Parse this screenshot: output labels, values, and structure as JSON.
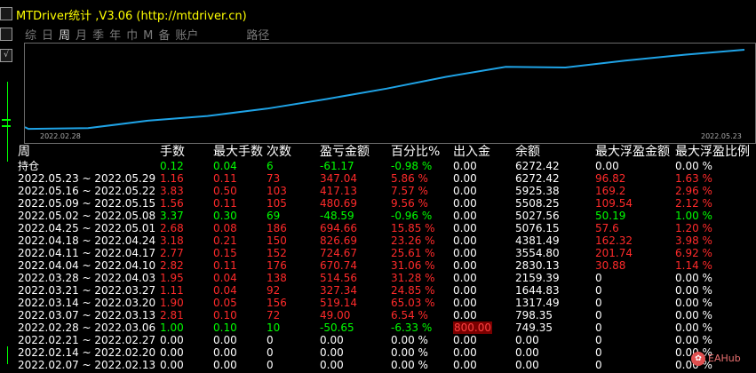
{
  "title": "MTDriver统计 ,V3.06 (http://mtdriver.cn)",
  "tabs": [
    {
      "label": "综"
    },
    {
      "label": "日"
    },
    {
      "label": "周"
    },
    {
      "label": "月"
    },
    {
      "label": "季"
    },
    {
      "label": "年"
    },
    {
      "label": "巾"
    },
    {
      "label": "M"
    },
    {
      "label": "备"
    },
    {
      "label": "账户"
    },
    {
      "label": "路径"
    }
  ],
  "active_tab": "周",
  "chart": {
    "start_date": "2022.02.28",
    "end_date": "2022.05.23",
    "line_color": "#1fa3e6"
  },
  "table": {
    "headers": [
      "周",
      "手数",
      "最大手数",
      "次数",
      "盈亏金额",
      "百分比%",
      "出入金",
      "余额",
      "最大浮盈金额",
      "最大浮盈比例"
    ],
    "rows": [
      {
        "week": "持仓",
        "lots": "0.12",
        "max_lots": "0.04",
        "count": "6",
        "pnl": "-61.17",
        "pct": "-0.98 %",
        "flow": "0.00",
        "balance": "6272.42",
        "max_float": "0.00",
        "max_float_pct": "0.00 %",
        "clr": "g"
      },
      {
        "week": "2022.05.23 ~ 2022.05.29",
        "lots": "1.16",
        "max_lots": "0.11",
        "count": "73",
        "pnl": "347.04",
        "pct": "5.86 %",
        "flow": "0.00",
        "balance": "6272.42",
        "max_float": "96.82",
        "max_float_pct": "1.63 %",
        "clr": "r"
      },
      {
        "week": "2022.05.16 ~ 2022.05.22",
        "lots": "3.83",
        "max_lots": "0.50",
        "count": "103",
        "pnl": "417.13",
        "pct": "7.57 %",
        "flow": "0.00",
        "balance": "5925.38",
        "max_float": "169.2",
        "max_float_pct": "2.96 %",
        "clr": "r"
      },
      {
        "week": "2022.05.09 ~ 2022.05.15",
        "lots": "1.56",
        "max_lots": "0.11",
        "count": "105",
        "pnl": "480.69",
        "pct": "9.56 %",
        "flow": "0.00",
        "balance": "5508.25",
        "max_float": "109.54",
        "max_float_pct": "2.12 %",
        "clr": "r"
      },
      {
        "week": "2022.05.02 ~ 2022.05.08",
        "lots": "3.37",
        "max_lots": "0.30",
        "count": "69",
        "pnl": "-48.59",
        "pct": "-0.96 %",
        "flow": "0.00",
        "balance": "5027.56",
        "max_float": "50.19",
        "max_float_pct": "1.00 %",
        "clr": "g"
      },
      {
        "week": "2022.04.25 ~ 2022.05.01",
        "lots": "2.68",
        "max_lots": "0.08",
        "count": "186",
        "pnl": "694.66",
        "pct": "15.85 %",
        "flow": "0.00",
        "balance": "5076.15",
        "max_float": "57.6",
        "max_float_pct": "1.20 %",
        "clr": "r"
      },
      {
        "week": "2022.04.18 ~ 2022.04.24",
        "lots": "3.18",
        "max_lots": "0.21",
        "count": "150",
        "pnl": "826.69",
        "pct": "23.26 %",
        "flow": "0.00",
        "balance": "4381.49",
        "max_float": "162.32",
        "max_float_pct": "3.98 %",
        "clr": "r"
      },
      {
        "week": "2022.04.11 ~ 2022.04.17",
        "lots": "2.77",
        "max_lots": "0.15",
        "count": "152",
        "pnl": "724.67",
        "pct": "25.61 %",
        "flow": "0.00",
        "balance": "3554.80",
        "max_float": "201.74",
        "max_float_pct": "6.92 %",
        "clr": "r"
      },
      {
        "week": "2022.04.04 ~ 2022.04.10",
        "lots": "2.82",
        "max_lots": "0.11",
        "count": "176",
        "pnl": "670.74",
        "pct": "31.06 %",
        "flow": "0.00",
        "balance": "2830.13",
        "max_float": "30.88",
        "max_float_pct": "1.14 %",
        "clr": "r"
      },
      {
        "week": "2022.03.28 ~ 2022.04.03",
        "lots": "1.95",
        "max_lots": "0.04",
        "count": "138",
        "pnl": "514.56",
        "pct": "31.28 %",
        "flow": "0.00",
        "balance": "2159.39",
        "max_float": "0",
        "max_float_pct": "0.00 %",
        "clr": "r"
      },
      {
        "week": "2022.03.21 ~ 2022.03.27",
        "lots": "1.11",
        "max_lots": "0.04",
        "count": "92",
        "pnl": "327.34",
        "pct": "24.85 %",
        "flow": "0.00",
        "balance": "1644.83",
        "max_float": "0",
        "max_float_pct": "0.00 %",
        "clr": "r"
      },
      {
        "week": "2022.03.14 ~ 2022.03.20",
        "lots": "1.90",
        "max_lots": "0.05",
        "count": "156",
        "pnl": "519.14",
        "pct": "65.03 %",
        "flow": "0.00",
        "balance": "1317.49",
        "max_float": "0",
        "max_float_pct": "0.00 %",
        "clr": "r"
      },
      {
        "week": "2022.03.07 ~ 2022.03.13",
        "lots": "2.81",
        "max_lots": "0.10",
        "count": "72",
        "pnl": "49.00",
        "pct": "6.54 %",
        "flow": "0.00",
        "balance": "798.35",
        "max_float": "0",
        "max_float_pct": "0.00 %",
        "clr": "r"
      },
      {
        "week": "2022.02.28 ~ 2022.03.06",
        "lots": "1.00",
        "max_lots": "0.10",
        "count": "10",
        "pnl": "-50.65",
        "pct": "-6.33 %",
        "flow": "800.00",
        "balance": "749.35",
        "max_float": "0",
        "max_float_pct": "0.00 %",
        "clr": "g",
        "flow_highlight": true
      },
      {
        "week": "2022.02.21 ~ 2022.02.27",
        "lots": "0.00",
        "max_lots": "0.00",
        "count": "0",
        "pnl": "0.00",
        "pct": "0.00 %",
        "flow": "0.00",
        "balance": "0.00",
        "max_float": "0",
        "max_float_pct": "0.00 %",
        "clr": "w"
      },
      {
        "week": "2022.02.14 ~ 2022.02.20",
        "lots": "0.00",
        "max_lots": "0.00",
        "count": "0",
        "pnl": "0.00",
        "pct": "0.00 %",
        "flow": "0.00",
        "balance": "0.00",
        "max_float": "0",
        "max_float_pct": "0.00 %",
        "clr": "w"
      },
      {
        "week": "2022.02.07 ~ 2022.02.13",
        "lots": "0.00",
        "max_lots": "0.00",
        "count": "0",
        "pnl": "0.00",
        "pct": "0.00 %",
        "flow": "0.00",
        "balance": "0.00",
        "max_float": "0",
        "max_float_pct": "0.00 %",
        "clr": "w"
      }
    ]
  },
  "watermark": "EAHub"
}
